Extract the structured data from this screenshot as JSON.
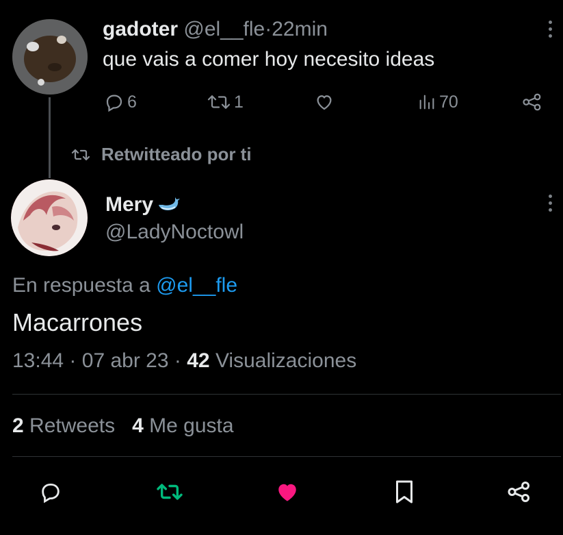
{
  "parent_tweet": {
    "display_name": "gadoter",
    "handle": "@el__fle",
    "separator": "·",
    "time": "22min",
    "text": "que vais a comer hoy necesito ideas",
    "replies": "6",
    "retweets": "1",
    "views": "70"
  },
  "retweet_note": "Retwitteado por ti",
  "main_tweet": {
    "display_name": "Mery",
    "handle": "@LadyNoctowl",
    "reply_prefix": "En respuesta a",
    "reply_to": "@el__fle",
    "text": "Macarrones",
    "time": "13:44",
    "date": "07 abr 23",
    "sep": "·",
    "views_count": "42",
    "views_label": "Visualizaciones",
    "retweets_count": "2",
    "retweets_label": "Retweets",
    "likes_count": "4",
    "likes_label": "Me gusta"
  },
  "colors": {
    "background": "#000000",
    "text": "#e7e9ea",
    "muted": "#8b9198",
    "link": "#1d9bf0",
    "retweet_active": "#00ba7c",
    "like_active": "#f91880"
  },
  "icons": [
    "more-icon",
    "reply-icon",
    "retweet-icon",
    "like-icon",
    "views-icon",
    "share-icon",
    "bookmark-icon",
    "whale-emoji-icon"
  ]
}
